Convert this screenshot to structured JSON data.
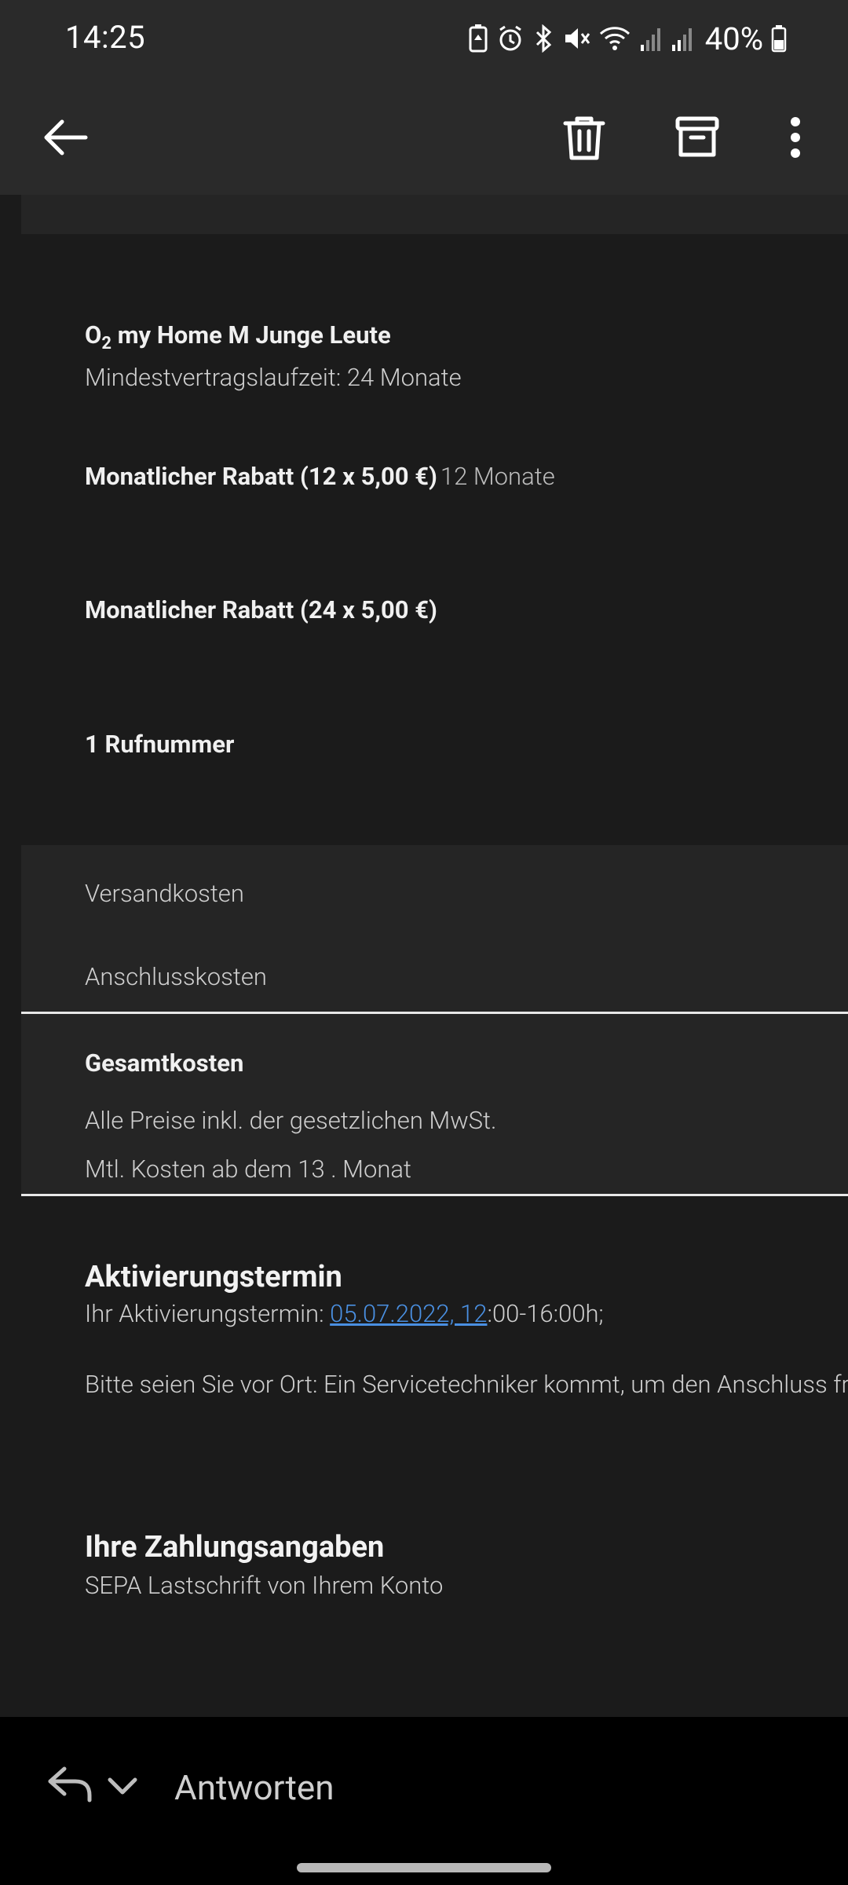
{
  "status_bar": {
    "time": "14:25",
    "battery": "40%"
  },
  "toolbar": {
    "icons": [
      "back-arrow-icon",
      "trash-icon",
      "archive-icon",
      "more-vert-icon"
    ]
  },
  "email": {
    "plan": {
      "brand_main": "O",
      "brand_sub": "2",
      "name": " my Home M Junge Leute",
      "term": "Mindestvertragslaufzeit: 24 Monate"
    },
    "discount1": {
      "label": "Monatlicher Rabatt (12 x 5,00 €)",
      "duration": "12 Monate"
    },
    "discount2": {
      "label": "Monatlicher Rabatt (24 x 5,00 €)"
    },
    "numbers": "1 Rufnummer",
    "costs": {
      "shipping": "Versandkosten",
      "connection": "Anschlusskosten",
      "total": "Gesamtkosten",
      "vat_note": "Alle Preise inkl. der gesetzlichen MwSt.",
      "monthly_note": "Mtl. Kosten ab dem 13 . Monat"
    },
    "activation": {
      "heading": "Aktivierungstermin",
      "prefix": "Ihr Aktivierungstermin: ",
      "date_link": "05.07.2022, 12",
      "suffix": ":00-16:00h;",
      "note": "Bitte seien Sie vor Ort: Ein Servicetechniker kommt, um den Anschluss fre"
    },
    "payment": {
      "heading": "Ihre Zahlungsangaben",
      "method": "SEPA Lastschrift von Ihrem Konto"
    }
  },
  "reply_bar": {
    "label": "Antworten"
  }
}
